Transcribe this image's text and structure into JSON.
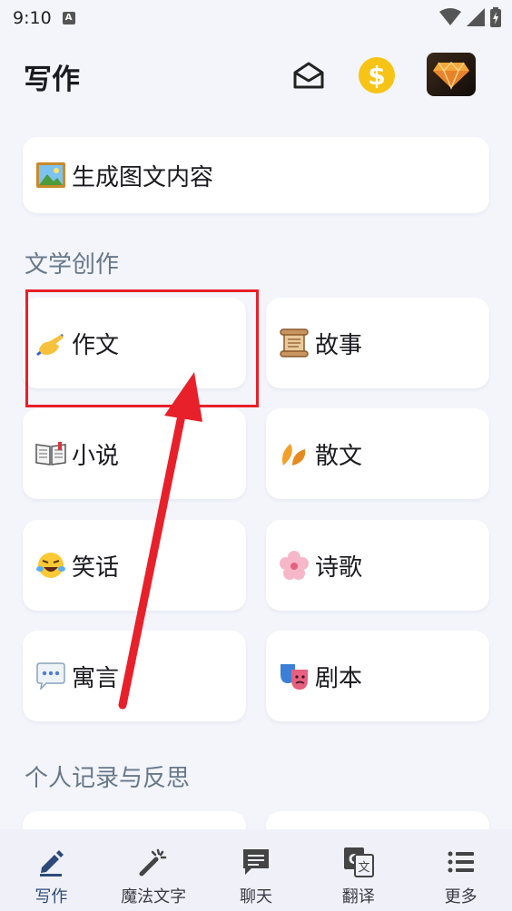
{
  "status": {
    "time": "9:10",
    "notif": "A"
  },
  "header": {
    "title": "写作"
  },
  "top_card": {
    "label": "生成图文内容"
  },
  "sections": [
    {
      "title": "文学创作"
    },
    {
      "title": "个人记录与反思"
    }
  ],
  "cards": [
    {
      "label": "作文",
      "icon": "writing-hand-icon"
    },
    {
      "label": "故事",
      "icon": "scroll-icon"
    },
    {
      "label": "小说",
      "icon": "open-book-icon"
    },
    {
      "label": "散文",
      "icon": "leaves-icon"
    },
    {
      "label": "笑话",
      "icon": "laughing-face-icon"
    },
    {
      "label": "诗歌",
      "icon": "blossom-icon"
    },
    {
      "label": "寓言",
      "icon": "speech-balloon-icon"
    },
    {
      "label": "剧本",
      "icon": "theater-masks-icon"
    }
  ],
  "bottom_nav": [
    {
      "label": "写作",
      "active": true
    },
    {
      "label": "魔法文字"
    },
    {
      "label": "聊天"
    },
    {
      "label": "翻译"
    },
    {
      "label": "更多"
    }
  ],
  "colors": {
    "accent": "#2c4a7a",
    "annotation": "#e8202a",
    "coin": "#f7c415"
  }
}
